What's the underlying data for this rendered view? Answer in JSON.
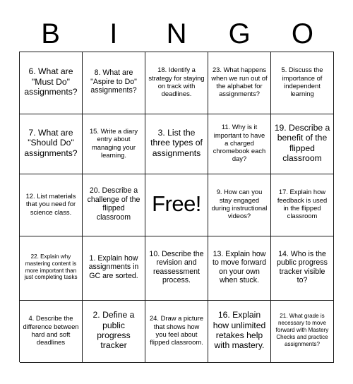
{
  "card": {
    "title_letters": [
      "B",
      "I",
      "N",
      "G",
      "O"
    ],
    "free_space_label": "Free!",
    "ink_color": "#000000",
    "border_color": "#1a1a1a",
    "background_color": "#ffffff",
    "rows": 5,
    "columns": 5,
    "cells": [
      {
        "id": "r1c1",
        "number": "6",
        "text": "6. What are \"Must Do\" assignments?",
        "size": "lg",
        "free": false
      },
      {
        "id": "r1c2",
        "number": "8",
        "text": "8. What are \"Aspire to Do\" assignments?",
        "size": "md",
        "free": false
      },
      {
        "id": "r1c3",
        "number": "18",
        "text": "18. Identify a strategy for staying on track with deadlines.",
        "size": "sm",
        "free": false
      },
      {
        "id": "r1c4",
        "number": "23",
        "text": "23. What happens when we run out of the alphabet for assignments?",
        "size": "sm",
        "free": false
      },
      {
        "id": "r1c5",
        "number": "5",
        "text": "5. Discuss the importance of independent learning",
        "size": "sm",
        "free": false
      },
      {
        "id": "r2c1",
        "number": "7",
        "text": "7. What are \"Should Do\" assignments?",
        "size": "lg",
        "free": false
      },
      {
        "id": "r2c2",
        "number": "15",
        "text": "15. Write a diary entry about managing your learning.",
        "size": "sm",
        "free": false
      },
      {
        "id": "r2c3",
        "number": "3",
        "text": "3. List the three types of assignments",
        "size": "lg",
        "free": false
      },
      {
        "id": "r2c4",
        "number": "11",
        "text": "11. Why is it important to have a charged chromebook each day?",
        "size": "sm",
        "free": false
      },
      {
        "id": "r2c5",
        "number": "19",
        "text": "19. Describe a benefit of the flipped classroom",
        "size": "lg",
        "free": false
      },
      {
        "id": "r3c1",
        "number": "12",
        "text": "12. List materials that you need for science class.",
        "size": "sm",
        "free": false
      },
      {
        "id": "r3c2",
        "number": "20",
        "text": "20. Describe a challenge of the flipped classroom",
        "size": "md",
        "free": false
      },
      {
        "id": "r3c3",
        "number": "",
        "text": "Free!",
        "size": "free",
        "free": true
      },
      {
        "id": "r3c4",
        "number": "9",
        "text": "9. How can you stay engaged during instructional videos?",
        "size": "sm",
        "free": false
      },
      {
        "id": "r3c5",
        "number": "17",
        "text": "17. Explain how feedback is used in the flipped classroom",
        "size": "sm",
        "free": false
      },
      {
        "id": "r4c1",
        "number": "22",
        "text": "22. Explain why mastering content is more important than just completing tasks",
        "size": "xs",
        "free": false
      },
      {
        "id": "r4c2",
        "number": "1",
        "text": "1. Explain how assignments in GC are sorted.",
        "size": "md",
        "free": false
      },
      {
        "id": "r4c3",
        "number": "10",
        "text": "10. Describe the revision and reassessment process.",
        "size": "md",
        "free": false
      },
      {
        "id": "r4c4",
        "number": "13",
        "text": "13. Explain how to move forward on your own when stuck.",
        "size": "md",
        "free": false
      },
      {
        "id": "r4c5",
        "number": "14",
        "text": "14. Who is the public progress tracker visible to?",
        "size": "md",
        "free": false
      },
      {
        "id": "r5c1",
        "number": "4",
        "text": "4. Describe the difference between hard and soft deadlines",
        "size": "sm",
        "free": false
      },
      {
        "id": "r5c2",
        "number": "2",
        "text": "2. Define a public progress tracker",
        "size": "lg",
        "free": false
      },
      {
        "id": "r5c3",
        "number": "24",
        "text": "24. Draw a picture that shows how you feel about flipped classroom.",
        "size": "sm",
        "free": false
      },
      {
        "id": "r5c4",
        "number": "16",
        "text": "16. Explain how unlimited retakes help with mastery.",
        "size": "lg",
        "free": false
      },
      {
        "id": "r5c5",
        "number": "21",
        "text": "21. What grade is necessary to move forward with Mastery Checks and practice assignments?",
        "size": "xs",
        "free": false
      }
    ]
  }
}
